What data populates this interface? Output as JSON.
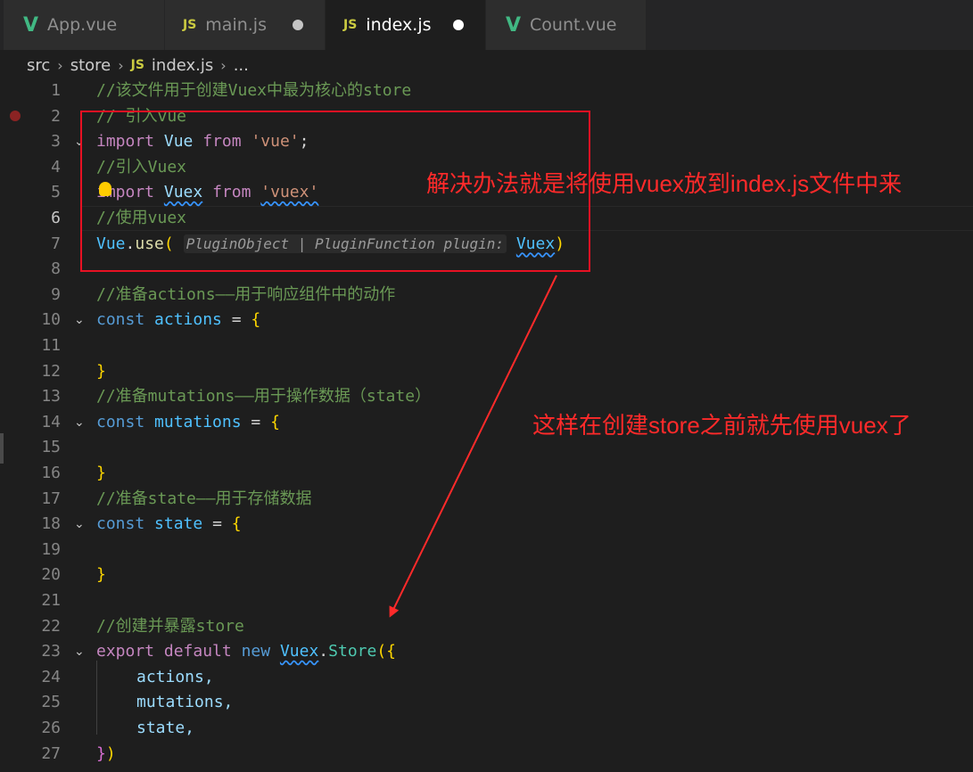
{
  "tabs": [
    {
      "label": "App.vue",
      "icon": "vue-icon",
      "icon_text": "V",
      "active": false,
      "modified": false
    },
    {
      "label": "main.js",
      "icon": "js-icon",
      "icon_text": "JS",
      "active": false,
      "modified": true
    },
    {
      "label": "index.js",
      "icon": "js-icon",
      "icon_text": "JS",
      "active": true,
      "modified": true
    },
    {
      "label": "Count.vue",
      "icon": "vue-icon",
      "icon_text": "V",
      "active": false,
      "modified": false
    }
  ],
  "breadcrumb": {
    "parts": [
      "src",
      "store",
      "index.js",
      "..."
    ],
    "file_icon_text": "JS",
    "separator": "›"
  },
  "line_numbers": [
    "1",
    "2",
    "3",
    "4",
    "5",
    "6",
    "7",
    "8",
    "9",
    "10",
    "11",
    "12",
    "13",
    "14",
    "15",
    "16",
    "17",
    "18",
    "19",
    "20",
    "21",
    "22",
    "23",
    "24",
    "25",
    "26",
    "27"
  ],
  "code": {
    "l1": "//该文件用于创建Vuex中最为核心的store",
    "l2": "// 引入vue",
    "l3": {
      "kw": "import",
      "id": "Vue",
      "from": "from",
      "str": "'vue'",
      "end": ";"
    },
    "l4": "//引入Vuex",
    "l5": {
      "kw": "import",
      "id": "Vuex",
      "from": "from",
      "str": "'vuex'"
    },
    "l6": "//使用vuex",
    "l7": {
      "obj": "Vue",
      "dot": ".",
      "fn": "use",
      "open": "(",
      "hint": "PluginObject | PluginFunction plugin:",
      "arg": "Vuex",
      "close": ")"
    },
    "l9": "//准备actions——用于响应组件中的动作",
    "l10": {
      "kw": "const",
      "id": "actions",
      "eq": "=",
      "brace": "{"
    },
    "l12": "}",
    "l13": "//准备mutations——用于操作数据（state）",
    "l14": {
      "kw": "const",
      "id": "mutations",
      "eq": "=",
      "brace": "{"
    },
    "l16": "}",
    "l17": "//准备state——用于存储数据",
    "l18": {
      "kw": "const",
      "id": "state",
      "eq": "=",
      "brace": "{"
    },
    "l20": "}",
    "l22": "//创建并暴露store",
    "l23": {
      "kw1": "export",
      "kw2": "default",
      "kw3": "new",
      "cls": "Vuex",
      "dot": ".",
      "member": "Store",
      "open": "({"
    },
    "l24": "actions,",
    "l25": "mutations,",
    "l26": "state,",
    "l27": {
      "brace": "}",
      "paren": ")"
    }
  },
  "annotations": {
    "top": "解决办法就是将使用vuex放到index.js文件中来",
    "middle": "这样在创建store之前就先使用vuex了"
  },
  "colors": {
    "annotation": "#ff2a2a",
    "comment": "#6a9955",
    "keyword": "#c586c0",
    "string": "#ce9178",
    "storage": "#569cd6",
    "variable": "#9cdcfe",
    "class": "#4fc1ff",
    "function": "#dcdcaa"
  }
}
